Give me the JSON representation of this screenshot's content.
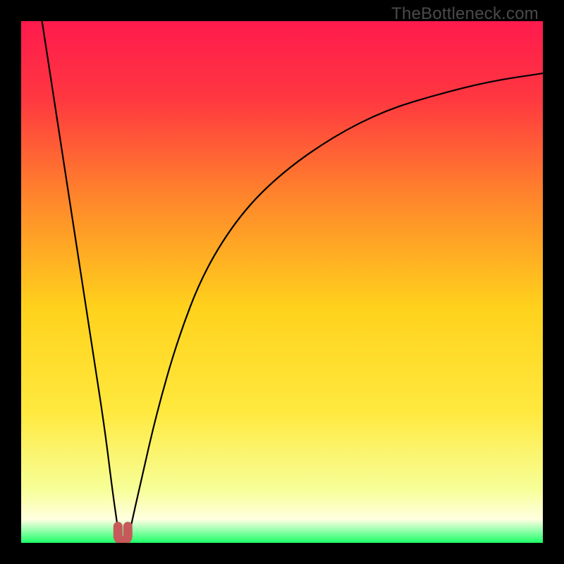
{
  "watermark": "TheBottleneck.com",
  "colors": {
    "bg_black": "#000000",
    "gradient_top": "#ff1a4d",
    "gradient_mid1": "#ff5a33",
    "gradient_mid2": "#ffb300",
    "gradient_mid3": "#ffe600",
    "gradient_low": "#f7ff66",
    "gradient_paleYellow": "#ffffcc",
    "gradient_green": "#1aff66",
    "curve_stroke": "#000000",
    "knot_fill": "#c65a5a"
  },
  "chart_data": {
    "type": "line",
    "title": "",
    "xlabel": "",
    "ylabel": "",
    "xlim": [
      0,
      1
    ],
    "ylim": [
      0,
      1
    ],
    "note": "Bottleneck-style absolute-difference curve. Axes unlabeled. The minimum (optimal point) is near x≈0.19. Left branch descends steeply from top-left; right branch rises toward y≈0.90 at x=1.",
    "series": [
      {
        "name": "left-branch",
        "x": [
          0.04,
          0.06,
          0.08,
          0.1,
          0.12,
          0.14,
          0.16,
          0.175,
          0.185
        ],
        "y": [
          1.0,
          0.87,
          0.74,
          0.61,
          0.48,
          0.35,
          0.22,
          0.1,
          0.03
        ]
      },
      {
        "name": "right-branch",
        "x": [
          0.21,
          0.23,
          0.26,
          0.3,
          0.35,
          0.42,
          0.5,
          0.6,
          0.7,
          0.8,
          0.9,
          1.0
        ],
        "y": [
          0.03,
          0.12,
          0.25,
          0.39,
          0.52,
          0.63,
          0.71,
          0.78,
          0.83,
          0.86,
          0.885,
          0.9
        ]
      }
    ],
    "minimum_marker": {
      "x": 0.195,
      "y": 0.01,
      "shape": "u-knot"
    },
    "background_gradient_stops": [
      {
        "pos": 0.0,
        "color": "#ff1a4d"
      },
      {
        "pos": 0.15,
        "color": "#ff3840"
      },
      {
        "pos": 0.35,
        "color": "#ff8a2a"
      },
      {
        "pos": 0.55,
        "color": "#ffd21c"
      },
      {
        "pos": 0.75,
        "color": "#ffe93f"
      },
      {
        "pos": 0.9,
        "color": "#f7ff9a"
      },
      {
        "pos": 0.955,
        "color": "#ffffe0"
      },
      {
        "pos": 0.975,
        "color": "#9cffb0"
      },
      {
        "pos": 1.0,
        "color": "#1aff66"
      }
    ]
  }
}
